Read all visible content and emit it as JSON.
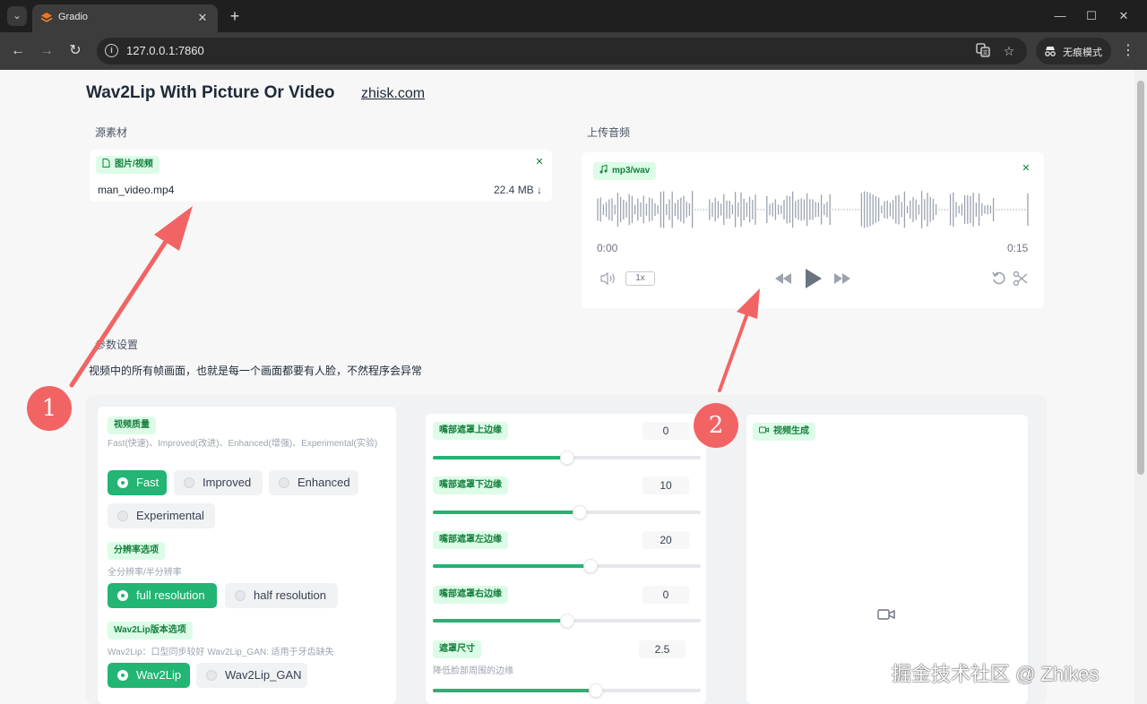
{
  "browser": {
    "tab_title": "Gradio",
    "url": "127.0.0.1:7860",
    "incognito_label": "无痕模式"
  },
  "page": {
    "title": "Wav2Lip With Picture Or Video",
    "link": "zhisk.com"
  },
  "source": {
    "label": "源素材",
    "tag": "图片/视频",
    "file_name": "man_video.mp4",
    "file_size": "22.4 MB ↓"
  },
  "audio": {
    "label": "上传音频",
    "tag": "mp3/wav",
    "time_start": "0:00",
    "time_end": "0:15",
    "rate": "1x"
  },
  "params": {
    "label": "参数设置",
    "description": "视频中的所有帧画面，也就是每一个画面都要有人脸，不然程序会异常"
  },
  "quality": {
    "tag": "视频质量",
    "info": "Fast(快速)、Improved(改进)、Enhanced(增强)、Experimental(实验)",
    "options": [
      "Fast",
      "Improved",
      "Enhanced",
      "Experimental"
    ],
    "selected": "Fast"
  },
  "resolution": {
    "tag": "分辨率选项",
    "info": "全分辨率/半分辨率",
    "options": [
      "full resolution",
      "half resolution"
    ],
    "selected": "full resolution"
  },
  "version": {
    "tag": "Wav2Lip版本选项",
    "info": "Wav2Lip：口型同步较好 Wav2Lip_GAN: 适用于牙齿缺失",
    "options": [
      "Wav2Lip",
      "Wav2Lip_GAN"
    ],
    "selected": "Wav2Lip"
  },
  "sliders": [
    {
      "label": "嘴部遮罩上边缘",
      "value": "0",
      "fraction": 0.5
    },
    {
      "label": "嘴部遮罩下边缘",
      "value": "10",
      "fraction": 0.55
    },
    {
      "label": "嘴部遮罩左边缘",
      "value": "20",
      "fraction": 0.59
    },
    {
      "label": "嘴部遮罩右边缘",
      "value": "0",
      "fraction": 0.5
    },
    {
      "label": "遮罩尺寸",
      "info": "降低脸部周围的边缘",
      "value": "2.5",
      "fraction": 0.61
    }
  ],
  "output": {
    "tag": "视频生成"
  },
  "annotations": {
    "marker_1": "1",
    "marker_2": "2",
    "watermark": "掘金技术社区 @ Zhikes"
  },
  "colors": {
    "accent": "#22b573",
    "tag_bg": "#dcfce7",
    "tag_text": "#15803d",
    "annotation": "#f26464"
  }
}
